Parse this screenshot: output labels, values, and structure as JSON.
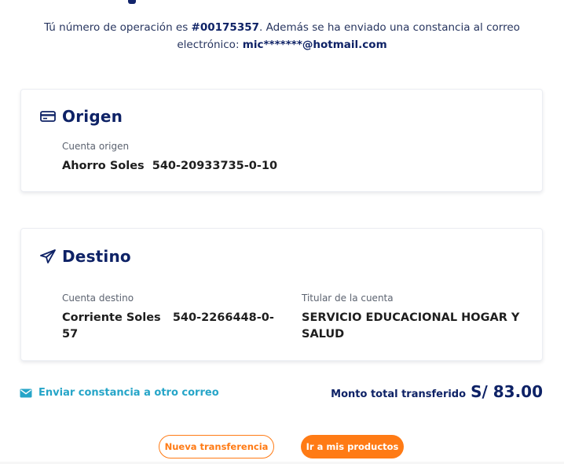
{
  "intro": {
    "text_before": "Tú número de operación es ",
    "operation_number": "#00175357",
    "text_middle": ". Además se ha enviado una constancia al correo electrónico: ",
    "email": "mic*******@hotmail.com"
  },
  "origen": {
    "title": "Origen",
    "icon": "credit-card-icon",
    "account_label": "Cuenta origen",
    "account_value": "Ahorro Soles  540-20933735-0-10"
  },
  "destino": {
    "title": "Destino",
    "icon": "paper-plane-icon",
    "account_label": "Cuenta destino",
    "account_value": "Corriente Soles   540-2266448-0-57",
    "holder_label": "Titular de la cuenta",
    "holder_value": "SERVICIO EDUCACIONAL HOGAR Y SALUD"
  },
  "actions": {
    "send_link": "Enviar constancia a otro correo",
    "send_icon": "envelope-icon",
    "total_label": "Monto total transferido",
    "total_amount": "S/ 83.00",
    "new_transfer": "Nueva transferencia",
    "go_products": "Ir a mis productos"
  },
  "colors": {
    "navy": "#0e2266",
    "accent_orange": "#ff7b15",
    "link_cyan": "#26a5c8"
  }
}
